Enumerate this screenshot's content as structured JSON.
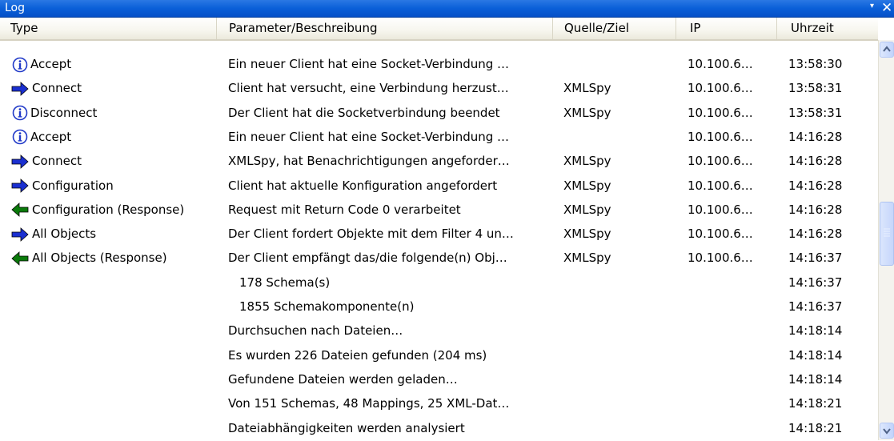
{
  "window": {
    "title": "Log",
    "pin_glyph": "▾",
    "close_glyph": "✕"
  },
  "columns": [
    "Type",
    "Parameter/Beschreibung",
    "Quelle/Ziel",
    "IP",
    "Uhrzeit"
  ],
  "rows": [
    {
      "icon": "info-icon",
      "type": "Accept",
      "desc": "Ein neuer Client hat eine Socket-Verbindung …",
      "src": "",
      "ip": "10.100.6…",
      "time": "13:58:30"
    },
    {
      "icon": "arrow-right-icon",
      "type": "Connect",
      "desc": "Client hat versucht, eine Verbindung herzust…",
      "src": "XMLSpy",
      "ip": "10.100.6…",
      "time": "13:58:31"
    },
    {
      "icon": "info-icon",
      "type": "Disconnect",
      "desc": "Der Client hat die Socketverbindung beendet",
      "src": "XMLSpy",
      "ip": "10.100.6…",
      "time": "13:58:31"
    },
    {
      "icon": "info-icon",
      "type": "Accept",
      "desc": "Ein neuer Client hat eine Socket-Verbindung …",
      "src": "",
      "ip": "10.100.6…",
      "time": "14:16:28"
    },
    {
      "icon": "arrow-right-icon",
      "type": "Connect",
      "desc": "XMLSpy, hat Benachrichtigungen angeforder…",
      "src": "XMLSpy",
      "ip": "10.100.6…",
      "time": "14:16:28"
    },
    {
      "icon": "arrow-right-icon",
      "type": "Configuration",
      "desc": "Client hat aktuelle Konfiguration angefordert",
      "src": "XMLSpy",
      "ip": "10.100.6…",
      "time": "14:16:28"
    },
    {
      "icon": "arrow-left-icon",
      "type": "Configuration (Response)",
      "desc": "Request mit Return Code 0 verarbeitet",
      "src": "XMLSpy",
      "ip": "10.100.6…",
      "time": "14:16:28"
    },
    {
      "icon": "arrow-right-icon",
      "type": "All Objects",
      "desc": "Der Client fordert Objekte mit dem Filter 4 un…",
      "src": "XMLSpy",
      "ip": "10.100.6…",
      "time": "14:16:28"
    },
    {
      "icon": "arrow-left-icon",
      "type": "All Objects (Response)",
      "desc": "Der Client empfängt das/die folgende(n) Obj…",
      "src": "XMLSpy",
      "ip": "10.100.6…",
      "time": "14:16:37"
    },
    {
      "icon": "",
      "type": "",
      "desc": "178 Schema(s)",
      "indent": true,
      "src": "",
      "ip": "",
      "time": "14:16:37"
    },
    {
      "icon": "",
      "type": "",
      "desc": "1855 Schemakomponente(n)",
      "indent": true,
      "src": "",
      "ip": "",
      "time": "14:16:37"
    },
    {
      "icon": "",
      "type": "",
      "desc": "Durchsuchen nach Dateien…",
      "src": "",
      "ip": "",
      "time": "14:18:14"
    },
    {
      "icon": "",
      "type": "",
      "desc": "Es wurden 226 Dateien gefunden (204 ms)",
      "src": "",
      "ip": "",
      "time": "14:18:14"
    },
    {
      "icon": "",
      "type": "",
      "desc": "Gefundene Dateien werden geladen…",
      "src": "",
      "ip": "",
      "time": "14:18:14"
    },
    {
      "icon": "",
      "type": "",
      "desc": "Von 151 Schemas, 48 Mappings, 25 XML-Dat…",
      "src": "",
      "ip": "",
      "time": "14:18:21"
    },
    {
      "icon": "",
      "type": "",
      "desc": "Dateiabhängigkeiten werden analysiert",
      "src": "",
      "ip": "",
      "time": "14:18:21"
    }
  ],
  "colors": {
    "titlebar": "#0a5fd8",
    "arrow_right": "#1a2fd0",
    "arrow_left": "#0a7a0a",
    "info": "#2039c8"
  }
}
